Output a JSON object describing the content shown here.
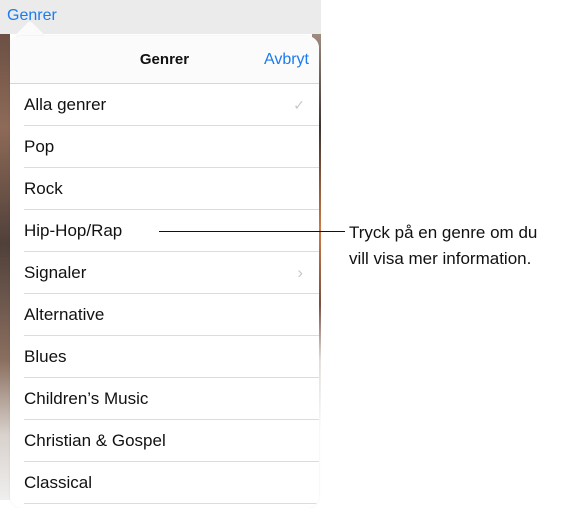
{
  "app": {
    "top_link": "Genrer"
  },
  "popover": {
    "title": "Genrer",
    "cancel_label": "Avbryt",
    "items": [
      {
        "label": "Alla genrer",
        "accessory": "checkmark-icon"
      },
      {
        "label": "Pop",
        "accessory": ""
      },
      {
        "label": "Rock",
        "accessory": ""
      },
      {
        "label": "Hip-Hop/Rap",
        "accessory": ""
      },
      {
        "label": "Signaler",
        "accessory": "chevron-right-icon"
      },
      {
        "label": "Alternative",
        "accessory": ""
      },
      {
        "label": "Blues",
        "accessory": ""
      },
      {
        "label": "Children’s Music",
        "accessory": ""
      },
      {
        "label": "Christian & Gospel",
        "accessory": ""
      },
      {
        "label": "Classical",
        "accessory": ""
      }
    ]
  },
  "callout": {
    "line1": "Tryck på en genre om du",
    "line2": "vill visa mer information."
  },
  "colors": {
    "accent": "#1a7cf0",
    "separator": "#dcdcde",
    "accessory": "#c7c7cc"
  }
}
